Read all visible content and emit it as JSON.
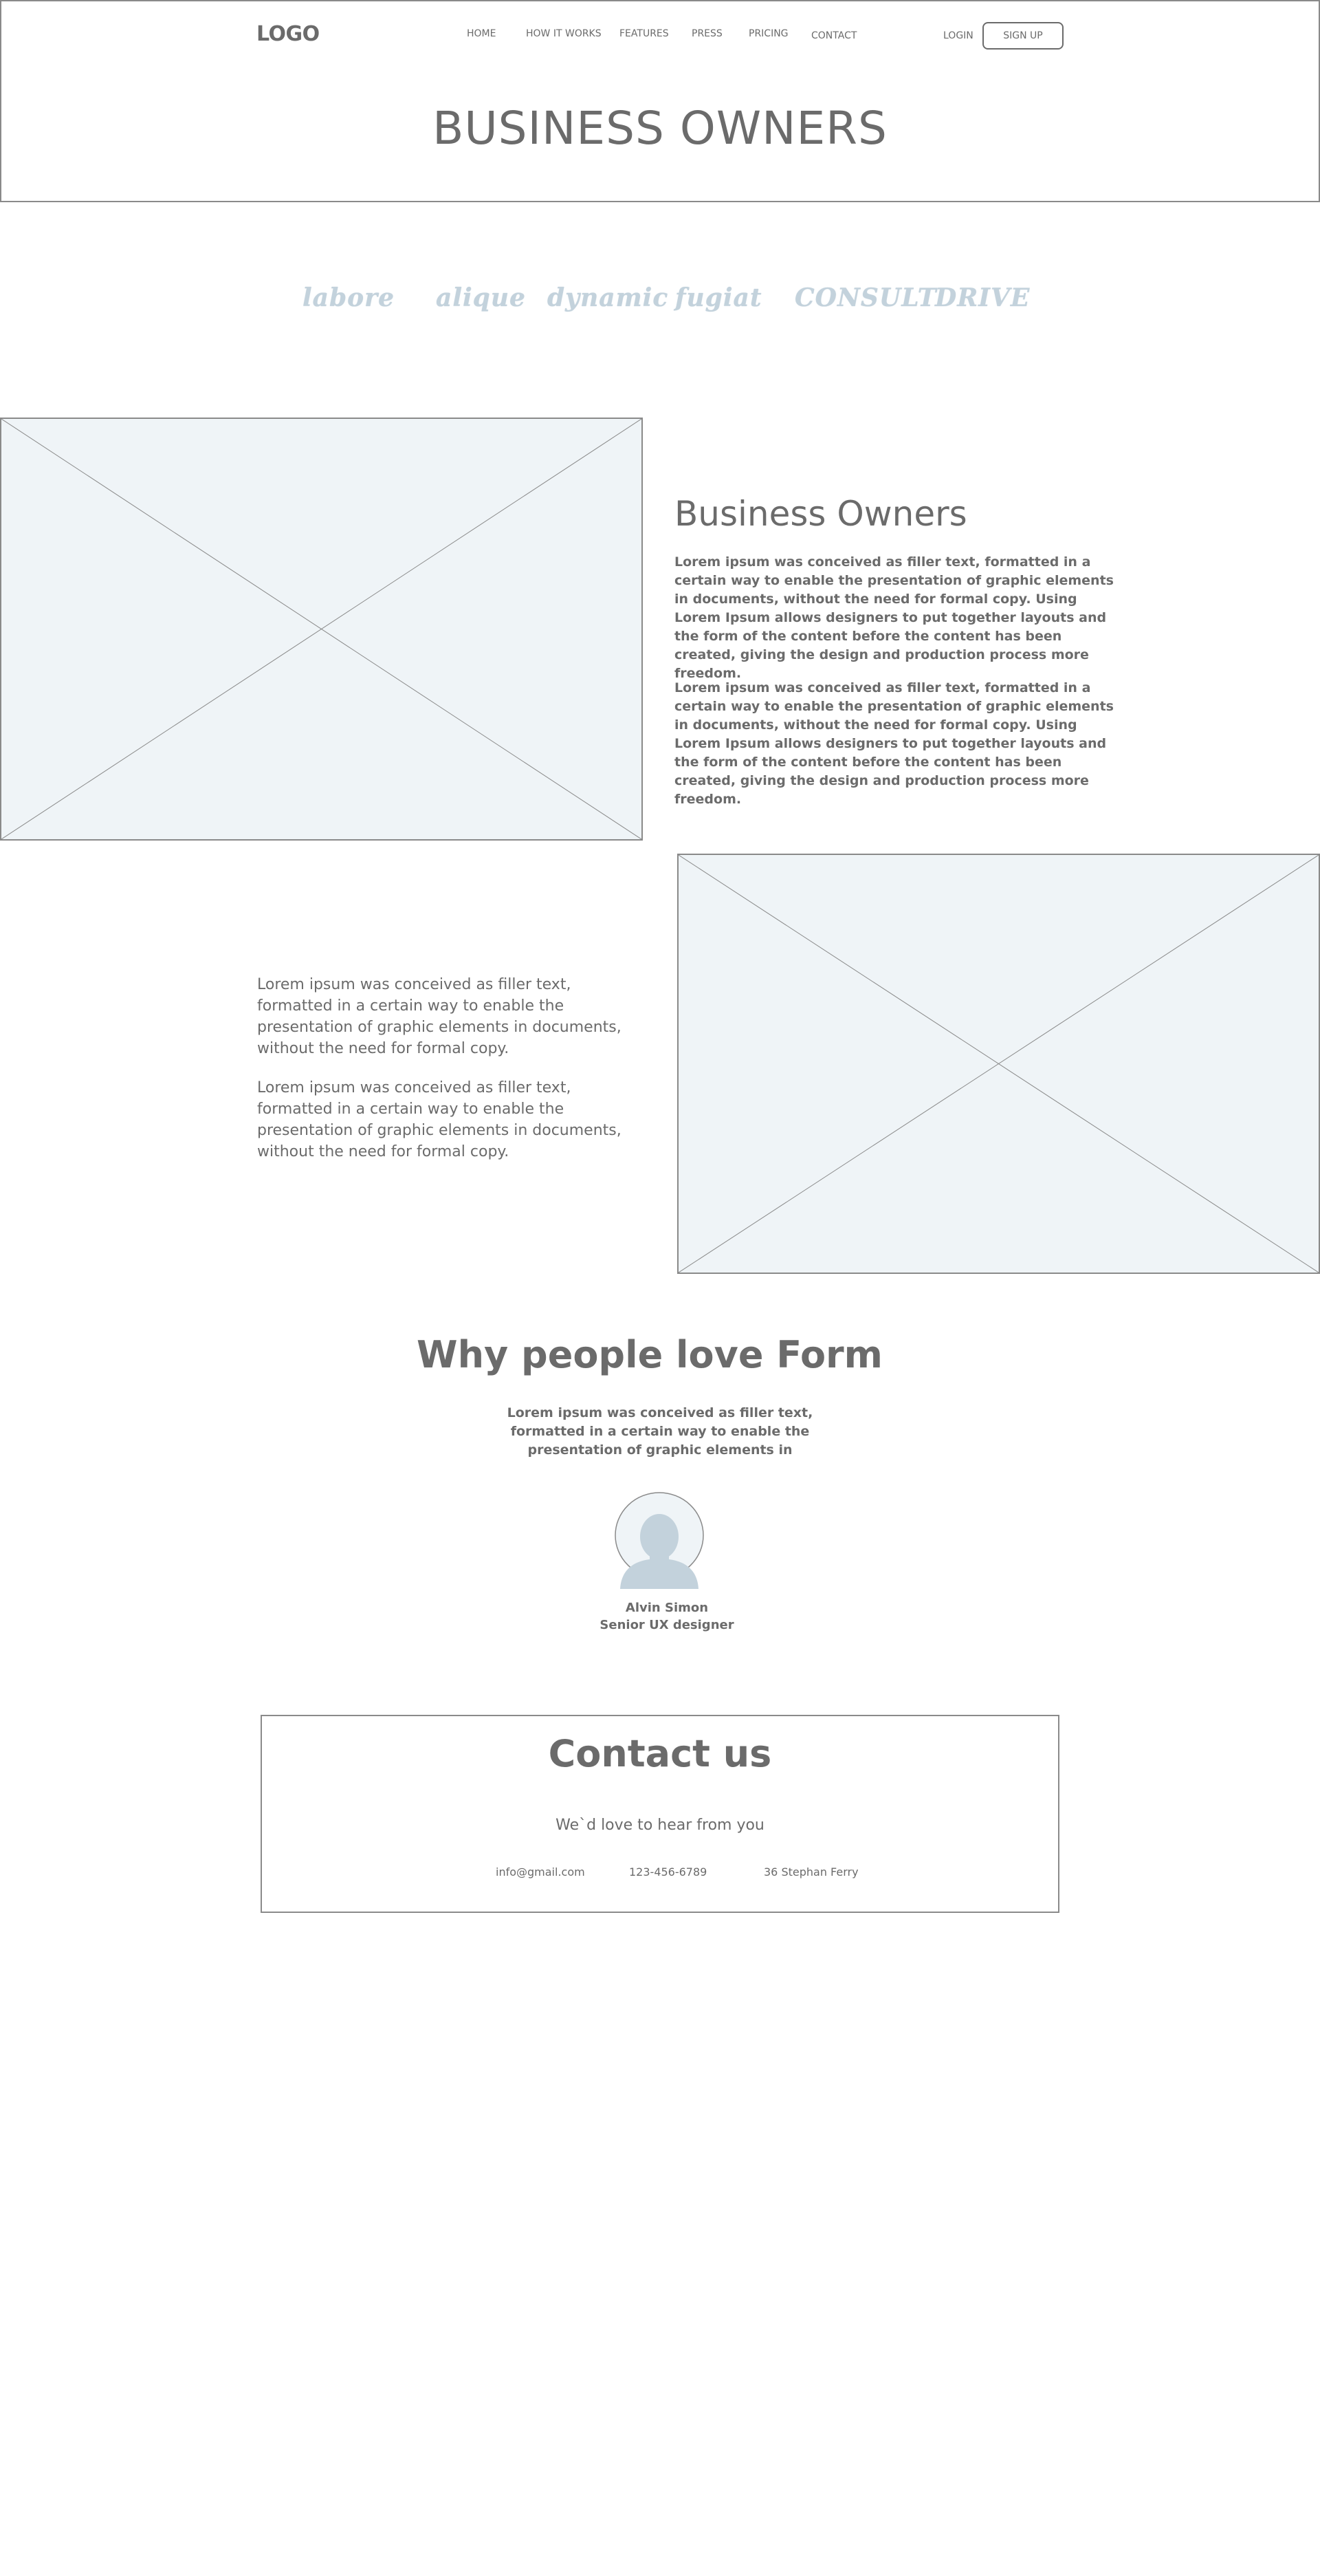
{
  "header": {
    "logo": "LOGO",
    "nav": [
      "HOME",
      "HOW IT WORKS",
      "FEATURES",
      "PRESS",
      "PRICING",
      "CONTACT"
    ],
    "login": "LOGIN",
    "signup": "SIGN UP"
  },
  "hero": {
    "title": "BUSINESS OWNERS"
  },
  "brands": [
    "labore",
    "alique",
    "dynamic",
    "fugiat",
    "CONSULT",
    "DRIVE"
  ],
  "business": {
    "title": "Business Owners",
    "paragraphs": [
      "Lorem ipsum was conceived as filler text, formatted in a certain way to enable the presentation of graphic elements in documents, without the need for formal copy. Using Lorem Ipsum allows designers to put together layouts and the form of the content before the content has been created, giving the design and production process more freedom.",
      "Lorem ipsum was conceived as filler text, formatted in a certain way to enable the presentation of graphic elements in documents, without the need for formal copy. Using Lorem Ipsum allows designers to put together layouts and the form of the content before the content has been created, giving the design and production process more freedom."
    ]
  },
  "left_text": {
    "paragraphs": [
      "Lorem ipsum was conceived as filler text, formatted in a certain way to enable the presentation of graphic elements in documents, without the need for formal copy.",
      "Lorem ipsum was conceived as filler text, formatted in a certain way to enable the presentation of graphic elements in documents, without the need for formal copy."
    ]
  },
  "testimonials": {
    "title": "Why people love Form",
    "subtitle": "Lorem ipsum was conceived as filler text, formatted in a certain way to enable the presentation of graphic elements in",
    "name": "Alvin Simon",
    "role": "Senior UX designer"
  },
  "contact": {
    "title": "Contact us",
    "subtitle": "We`d love to hear from you",
    "email": "info@gmail.com",
    "phone": "123-456-6789",
    "address": "36 Stephan Ferry"
  },
  "colors": {
    "text": "#6b6b6b",
    "border": "#8a8a8a",
    "placeholder_fill": "#eff4f7",
    "accent_light": "#c3d2dc"
  }
}
